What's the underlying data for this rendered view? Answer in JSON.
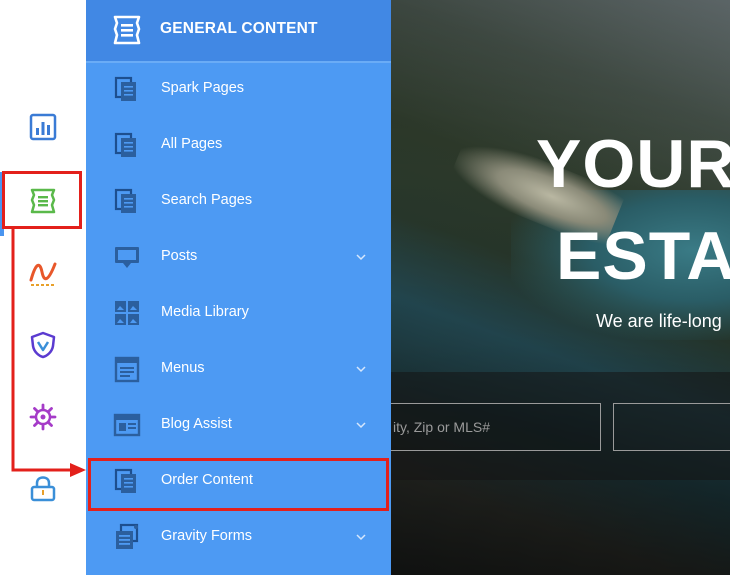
{
  "rail": {
    "items": [
      {
        "icon": "analytics-bar-chart-icon",
        "color": "#3a7bd5"
      },
      {
        "icon": "general-content-icon",
        "color": "#5ab94a"
      },
      {
        "icon": "marketing-wave-icon",
        "color": "#e8572a"
      },
      {
        "icon": "security-shield-icon",
        "color": "#5b3bd0"
      },
      {
        "icon": "settings-gear-icon",
        "color": "#a53bc8"
      },
      {
        "icon": "lock-icon",
        "color": "#3a8fd8"
      }
    ],
    "active_index": 1
  },
  "menu": {
    "header_title": "GENERAL CONTENT",
    "items": [
      {
        "label": "Spark Pages",
        "icon": "pages-icon",
        "has_submenu": false
      },
      {
        "label": "All Pages",
        "icon": "pages-icon",
        "has_submenu": false
      },
      {
        "label": "Search Pages",
        "icon": "pages-icon",
        "has_submenu": false
      },
      {
        "label": "Posts",
        "icon": "monitor-icon",
        "has_submenu": true
      },
      {
        "label": "Media Library",
        "icon": "media-grid-icon",
        "has_submenu": false
      },
      {
        "label": "Menus",
        "icon": "menu-doc-icon",
        "has_submenu": true
      },
      {
        "label": "Blog Assist",
        "icon": "blog-layout-icon",
        "has_submenu": true
      },
      {
        "label": "Order Content",
        "icon": "pages-icon",
        "has_submenu": false,
        "highlighted": true
      },
      {
        "label": "Gravity Forms",
        "icon": "forms-icon",
        "has_submenu": true
      }
    ],
    "colors": {
      "background": "#4d9af3",
      "header": "#4188e4",
      "highlight": "#e3201b"
    }
  },
  "site": {
    "hero_line1": "YOUR",
    "hero_line2": "ESTAT",
    "subtitle": "We are life-long",
    "search_placeholder": "ity, Zip or MLS#"
  }
}
